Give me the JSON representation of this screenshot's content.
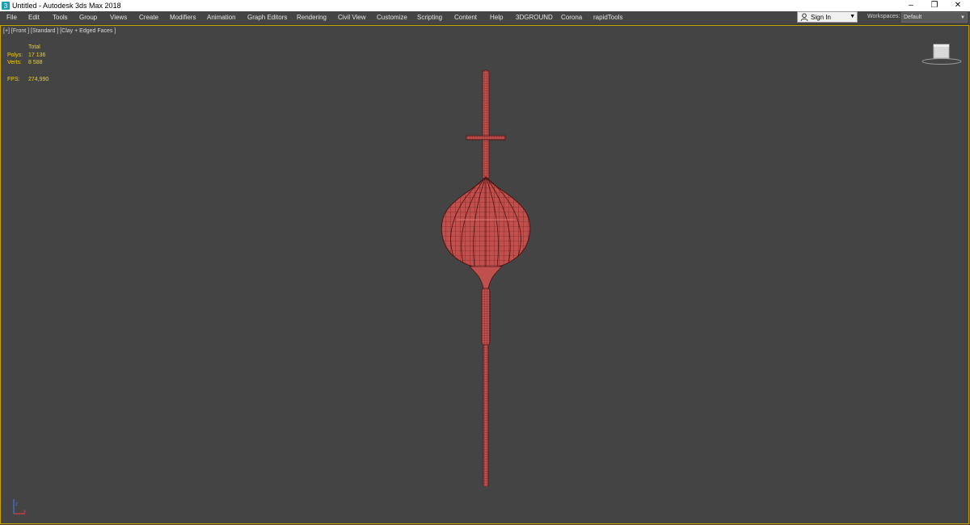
{
  "window": {
    "title": "Untitled - Autodesk 3ds Max 2018",
    "controls": {
      "minimize": "–",
      "restore": "❐",
      "close": "✕"
    }
  },
  "menu": [
    {
      "label": "File"
    },
    {
      "label": "Edit"
    },
    {
      "label": "Tools"
    },
    {
      "label": "Group"
    },
    {
      "label": "Views"
    },
    {
      "label": "Create"
    },
    {
      "label": "Modifiers"
    },
    {
      "label": "Animation"
    },
    {
      "label": "Graph Editors"
    },
    {
      "label": "Rendering"
    },
    {
      "label": "Civil View"
    },
    {
      "label": "Customize"
    },
    {
      "label": "Scripting"
    },
    {
      "label": "Content"
    },
    {
      "label": "Help"
    },
    {
      "label": "3DGROUND"
    },
    {
      "label": "Corona"
    },
    {
      "label": "rapidTools"
    }
  ],
  "account": {
    "sign_in_label": "Sign In",
    "icon": "user-icon"
  },
  "workspaces": {
    "label": "Workspaces:",
    "value": "Default"
  },
  "viewport": {
    "label": "[+] [Front ] [Standard ] [Clay + Edged Faces ]",
    "stats": {
      "header": "Total",
      "polys_label": "Polys:",
      "polys_value": "17 136",
      "verts_label": "Verts:",
      "verts_value": "8 588",
      "fps_label": "FPS:",
      "fps_value": "274,990"
    },
    "model_color": "#c0504d",
    "border_color": "#c8a400"
  }
}
